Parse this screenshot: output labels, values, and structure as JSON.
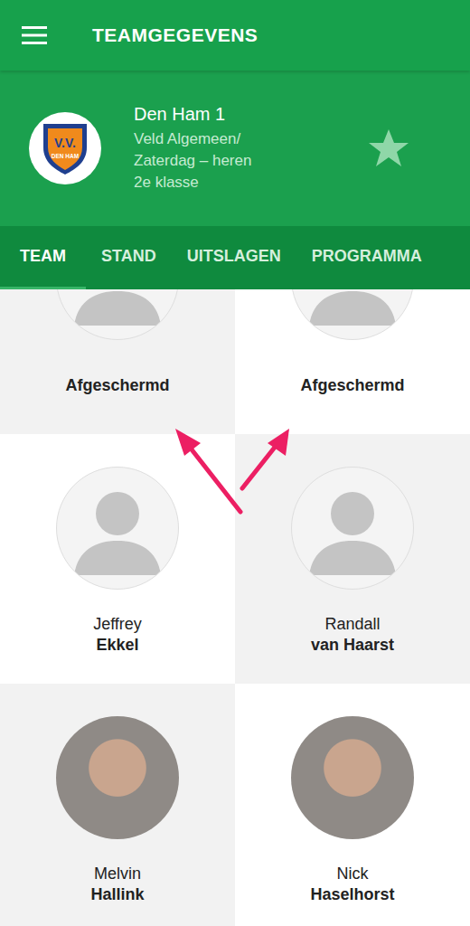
{
  "appbar": {
    "title": "TEAMGEGEVENS"
  },
  "logo": {
    "initials": "V.V.",
    "name": "DEN HAM"
  },
  "team": {
    "name": "Den Ham 1",
    "details": [
      "Veld Algemeen/",
      "Zaterdag – heren",
      "2e klasse"
    ]
  },
  "tabs": [
    {
      "label": "TEAM",
      "selected": true
    },
    {
      "label": "STAND",
      "selected": false
    },
    {
      "label": "UITSLAGEN",
      "selected": false
    },
    {
      "label": "PROGRAMMA",
      "selected": false
    }
  ],
  "players": [
    {
      "first_name": "",
      "last_name": "Afgeschermd",
      "photo": false
    },
    {
      "first_name": "",
      "last_name": "Afgeschermd",
      "photo": false
    },
    {
      "first_name": "Jeffrey",
      "last_name": "Ekkel",
      "photo": false
    },
    {
      "first_name": "Randall",
      "last_name": "van Haarst",
      "photo": false
    },
    {
      "first_name": "Melvin",
      "last_name": "Hallink",
      "photo": true
    },
    {
      "first_name": "Nick",
      "last_name": "Haselhorst",
      "photo": true
    }
  ]
}
